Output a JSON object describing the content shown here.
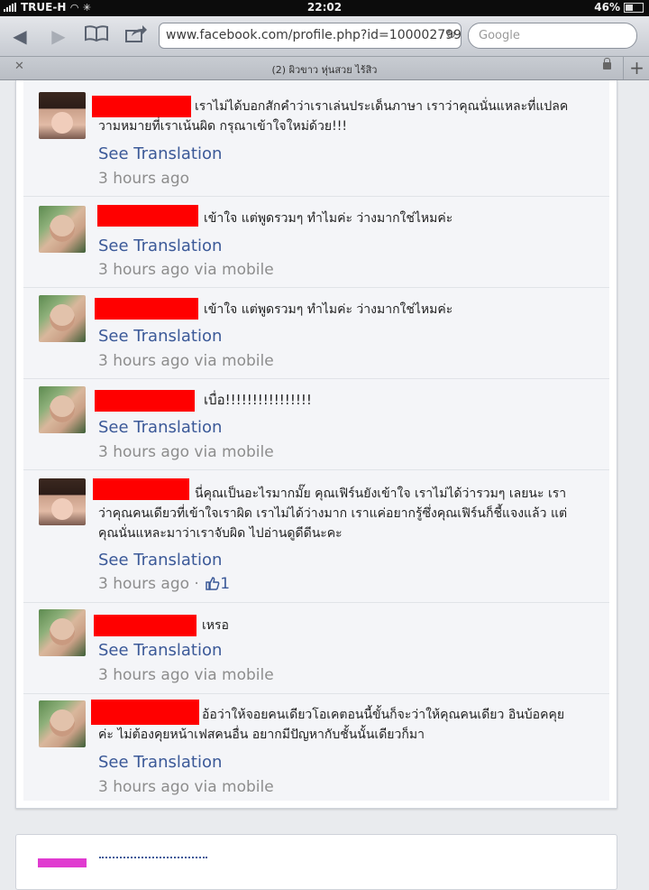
{
  "status_bar": {
    "carrier": "TRUE-H",
    "time": "22:02",
    "battery": "46%"
  },
  "browser": {
    "url": "www.facebook.com/profile.php?id=10000279990",
    "search_placeholder": "Google",
    "tab_title": "(2) ผิวขาว หุ่นสวย ไร้สิว"
  },
  "comments": [
    {
      "avatar": "girl-photo",
      "text": "เราไม่ได้บอกสักคำว่าเราเล่นประเด็นภาษา เราว่าคุณนั่นแหละที่แปลความหมายที่เราเน้นผิด กรุณาเข้าใจใหม่ด้วย!!!",
      "translate": "See Translation",
      "meta": "3 hours ago"
    },
    {
      "avatar": "peace-sign-photo",
      "text": "เข้าใจ แต่พูดรวมๆ ทำไมค่ะ ว่างมากใช่ไหมค่ะ",
      "translate": "See Translation",
      "meta": "3 hours ago via mobile"
    },
    {
      "avatar": "peace-sign-photo",
      "text": "เข้าใจ แต่พูดรวมๆ ทำไมค่ะ ว่างมากใช่ไหมค่ะ",
      "translate": "See Translation",
      "meta": "3 hours ago via mobile"
    },
    {
      "avatar": "peace-sign-photo",
      "text": "เบื่อ!!!!!!!!!!!!!!!!",
      "translate": "See Translation",
      "meta": "3 hours ago via mobile"
    },
    {
      "avatar": "girl-photo",
      "text": "นี่คุณเป็นอะไรมากมั๊ย คุณเฟิร์นยังเข้าใจ เราไม่ได้ว่ารวมๆ เลยนะ เราว่าคุณคนเดียวที่เข้าใจเราผิด เราไม่ได้ว่างมาก เราแค่อยากรู้ซึ่งคุณเฟิร์นก็ชี้แจงแล้ว แต่คุณนั่นแหละมาว่าเราจับผิด ไปอ่านดูดีดีนะคะ",
      "translate": "See Translation",
      "meta": "3 hours ago ·",
      "likes": "1"
    },
    {
      "avatar": "peace-sign-photo",
      "text": "เหรอ",
      "translate": "See Translation",
      "meta": "3 hours ago via mobile"
    },
    {
      "avatar": "peace-sign-photo",
      "text": "อ้อว่าให้จอยคนเดียวโอเคตอนนี้ขั้นก็จะว่าให้คุณคนเดียว อินบ้อคคุยค่ะ ไม่ต้องคุยหน้าเฟสคนอื่น อยากมีปัญหากับชั้นนั้นเดียวก็มา",
      "translate": "See Translation",
      "meta": "3 hours ago via mobile"
    }
  ],
  "colors": {
    "link": "#3b5998",
    "redaction": "#ff0000",
    "meta": "#8d8d8d"
  }
}
